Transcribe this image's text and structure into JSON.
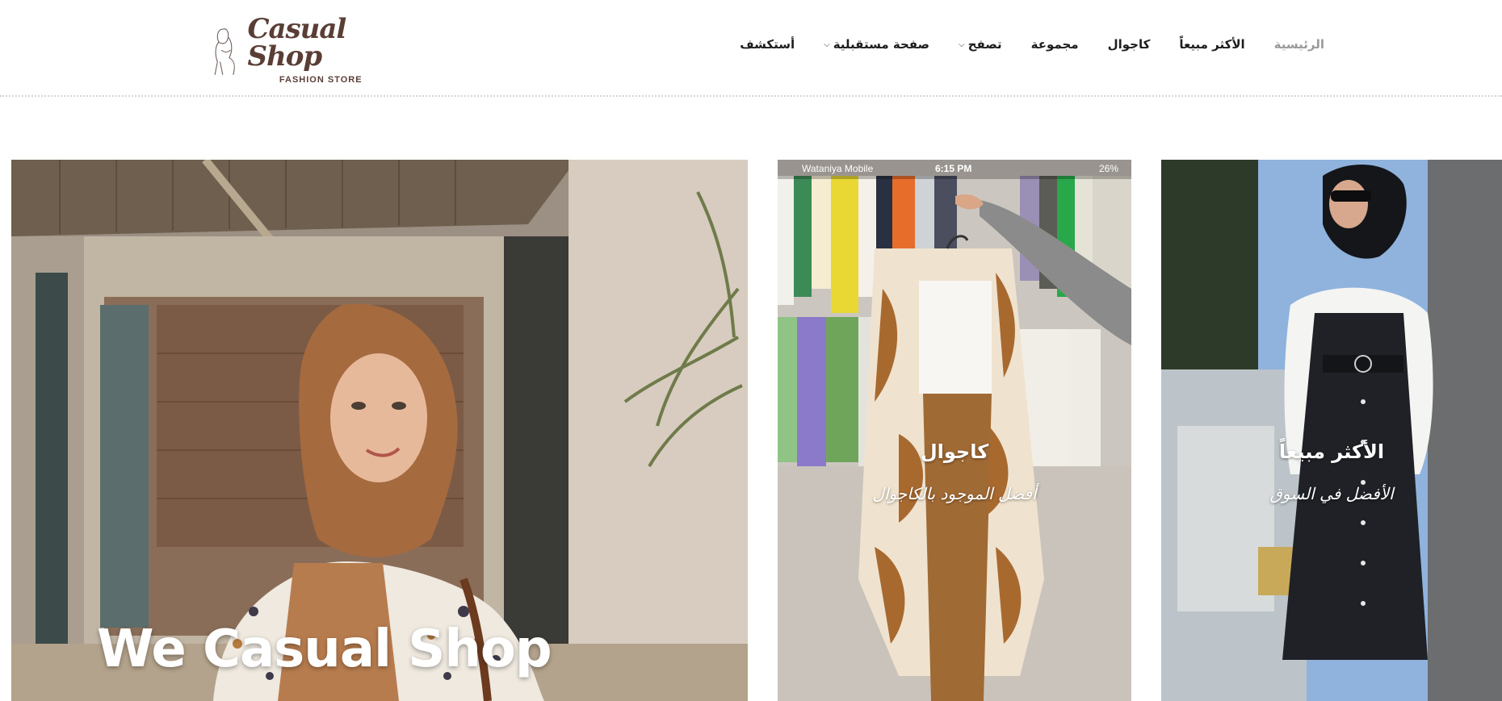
{
  "logo": {
    "script_text": "Casual Shop",
    "sub_text": "FASHION STORE",
    "brand_color": "#5a3e35"
  },
  "nav": {
    "items": [
      {
        "label": "أستكشف",
        "has_dropdown": false
      },
      {
        "label": "صفحة مستقبلية",
        "has_dropdown": true
      },
      {
        "label": "تصفح",
        "has_dropdown": true
      },
      {
        "label": "مجموعة",
        "has_dropdown": false
      },
      {
        "label": "كاجوال",
        "has_dropdown": false
      },
      {
        "label": "الأكثر مبيعاً",
        "has_dropdown": false
      },
      {
        "label": "الرئيسية",
        "has_dropdown": false,
        "muted": true
      }
    ],
    "chevron_icon": "chevron-down-icon"
  },
  "hero": {
    "main_title": "We Casual Shop",
    "mid_panel": {
      "title": "كاجوال",
      "subtitle": "أفضل الموجود بالكاجوال",
      "status_bar": {
        "carrier": "Wataniya Mobile",
        "time": "6:15 PM",
        "battery": "26%"
      }
    },
    "right_panel": {
      "title": "الأكثر مبيعاً",
      "subtitle": "الأفضل في السوق"
    }
  }
}
